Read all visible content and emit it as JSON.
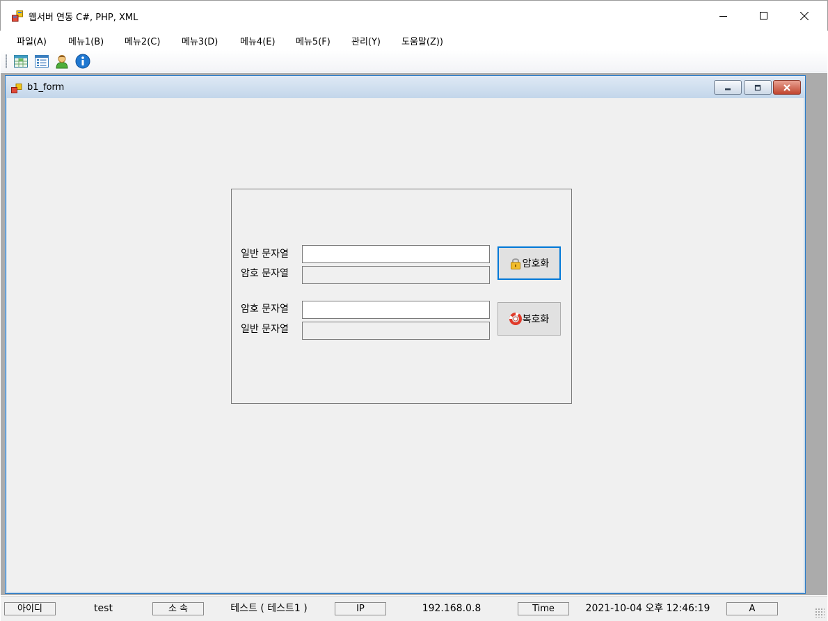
{
  "window": {
    "title": "웹서버 연동 C#, PHP, XML",
    "icon": "app-window-icon",
    "controls": [
      "minimize-icon",
      "maximize-icon",
      "close-icon"
    ]
  },
  "menu": [
    {
      "label": "파일(A)"
    },
    {
      "label": "메뉴1(B)"
    },
    {
      "label": "메뉴2(C)"
    },
    {
      "label": "메뉴3(D)"
    },
    {
      "label": "메뉴4(E)"
    },
    {
      "label": "메뉴5(F)"
    },
    {
      "label": "관리(Y)"
    },
    {
      "label": "도움말(Z))"
    }
  ],
  "toolbar": [
    {
      "icon": "spreadsheet-icon"
    },
    {
      "icon": "list-icon"
    },
    {
      "icon": "user-icon"
    },
    {
      "icon": "info-icon"
    }
  ],
  "child": {
    "title": "b1_form",
    "encrypt": {
      "plain_label": "일반 문자열",
      "plain_value": "",
      "cipher_label": "암호 문자열",
      "cipher_value": "",
      "button_label": "암호화",
      "button_icon": "lock-icon"
    },
    "decrypt": {
      "cipher_label": "암호 문자열",
      "cipher_value": "",
      "plain_label": "일반 문자열",
      "plain_value": "",
      "button_label": "복호화",
      "button_icon": "lifebuoy-icon"
    }
  },
  "status": {
    "id_label": "아이디",
    "id_value": "test",
    "dept_label": "소 속",
    "dept_value": "테스트 ( 테스트1 )",
    "ip_label": "IP",
    "ip_value": "192.168.0.8",
    "time_label": "Time",
    "time_value": "2021-10-04 오후 12:46:19",
    "extra_value": "A"
  },
  "colors": {
    "accent": "#0078d7",
    "mdi_background": "#ababab",
    "form_background": "#f0f0f0",
    "child_title_gradient": "#c3d6ea"
  }
}
